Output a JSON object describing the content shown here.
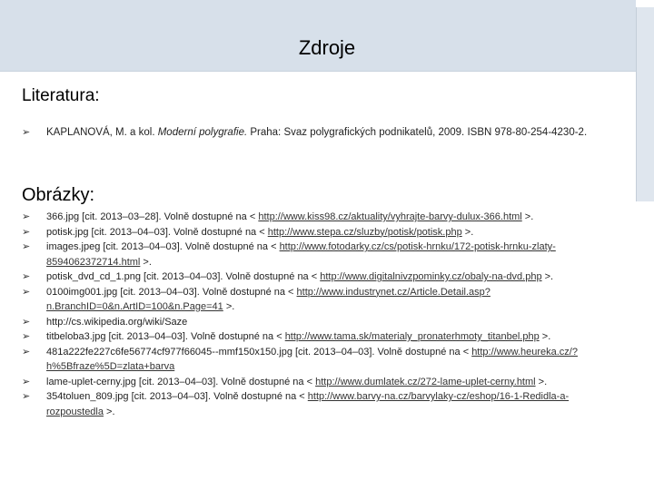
{
  "title": "Zdroje",
  "literatura": {
    "heading": "Literatura:",
    "items": [
      {
        "pre": "KAPLANOVÁ, M. a kol. ",
        "italic": "Moderní polygrafie.",
        "post": " Praha: Svaz polygrafických podnikatelů, 2009. ISBN 978-80-254-4230-2."
      }
    ]
  },
  "obrazky": {
    "heading": "Obrázky:",
    "items": [
      {
        "text": "366.jpg [cit. 2013–03–28]. Volně dostupné na < ",
        "link": "http://www.kiss98.cz/aktuality/vyhrajte-barvy-dulux-366.html",
        "after": " >."
      },
      {
        "text": "potisk.jpg [cit. 2013–04–03]. Volně dostupné na < ",
        "link": "http://www.stepa.cz/sluzby/potisk/potisk.php",
        "after": " >."
      },
      {
        "text": "images.jpeg [cit. 2013–04–03]. Volně dostupné na < ",
        "link": "http://www.fotodarky.cz/cs/potisk-hrnku/172-potisk-hrnku-zlaty-8594062372714.html",
        "after": " >."
      },
      {
        "text": "potisk_dvd_cd_1.png [cit. 2013–04–03]. Volně dostupné na < ",
        "link": "http://www.digitalnivzpominky.cz/obaly-na-dvd.php",
        "after": " >."
      },
      {
        "text": "0100img001.jpg [cit. 2013–04–03]. Volně dostupné na < ",
        "link": "http://www.industrynet.cz/Article.Detail.asp?n.BranchID=0&n.ArtID=100&n.Page=41",
        "after": " >."
      },
      {
        "text": "http://cs.wikipedia.org/wiki/Saze",
        "link": "",
        "after": ""
      },
      {
        "text": "titbeloba3.jpg [cit. 2013–04–03]. Volně dostupné na < ",
        "link": "http://www.tama.sk/materialy_pronaterhmoty_titanbel.php",
        "after": " >."
      },
      {
        "text": "481a222fe227c6fe56774cf977f66045--mmf150x150.jpg [cit. 2013–04–03]. Volně dostupné na < ",
        "link": "http://www.heureka.cz/?h%5Bfraze%5D=zlata+barva",
        "after": ""
      },
      {
        "text": "lame-uplet-cerny.jpg [cit. 2013–04–03]. Volně dostupné na < ",
        "link": "http://www.dumlatek.cz/272-lame-uplet-cerny.html",
        "after": " >."
      },
      {
        "text": "354toluen_809.jpg [cit. 2013–04–03]. Volně dostupné na < ",
        "link": "http://www.barvy-na.cz/barvylaky-cz/eshop/16-1-Redidla-a-rozpoustedla",
        "after": " >."
      }
    ]
  },
  "bullet_glyph": "➢"
}
